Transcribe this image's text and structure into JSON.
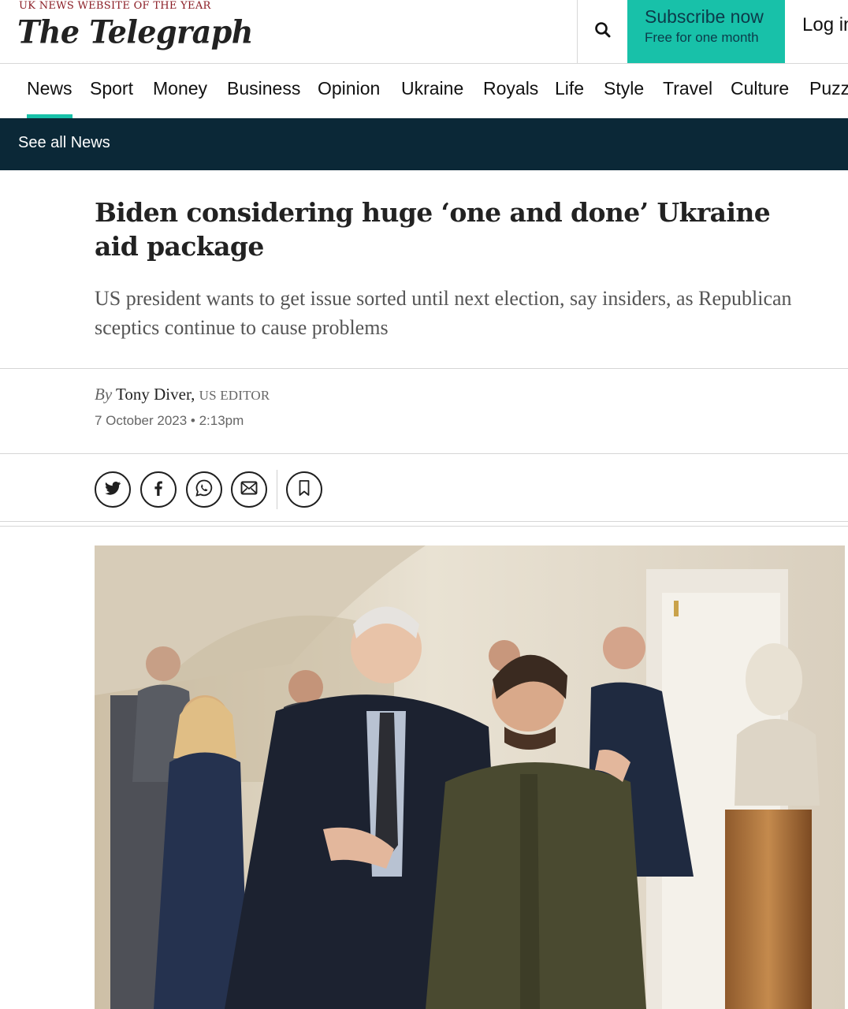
{
  "header": {
    "tagline": "UK NEWS WEBSITE OF THE YEAR",
    "logo": "The Telegraph",
    "search_icon": "search-icon",
    "subscribe_label": "Subscribe now",
    "subscribe_sub": "Free for one month",
    "login_label": "Log in",
    "accent_color": "#18c1a9"
  },
  "nav": {
    "items": [
      "News",
      "Sport",
      "Money",
      "Business",
      "Opinion",
      "Ukraine",
      "Royals",
      "Life",
      "Style",
      "Travel",
      "Culture",
      "Puzzles"
    ],
    "active": "News"
  },
  "section_bar": {
    "label": "See all News",
    "color": "#0b2837"
  },
  "article": {
    "headline": "Biden considering huge ‘one and done’ Ukraine aid package",
    "standfirst": "US president wants to get issue sorted until next election, say insiders, as Republican sceptics continue to cause problems",
    "byline_prefix": "By",
    "author": "Tony Diver,",
    "author_role": "US EDITOR",
    "date": "7 October 2023 • 2:13pm"
  },
  "share": {
    "icons": [
      "twitter-icon",
      "facebook-icon",
      "whatsapp-icon",
      "email-icon",
      "bookmark-icon"
    ]
  }
}
